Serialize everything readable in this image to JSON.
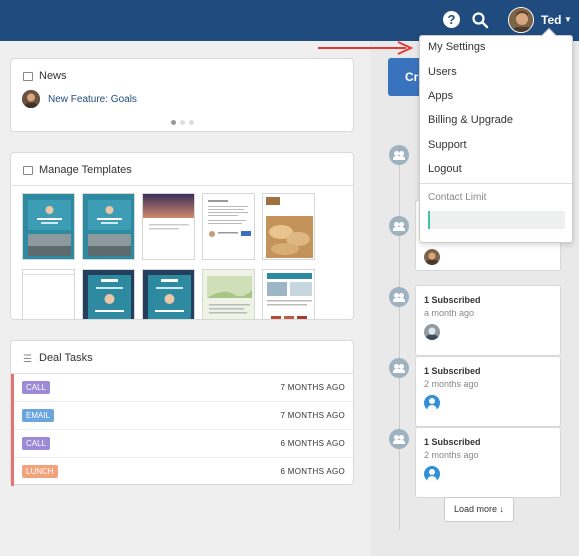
{
  "topbar": {
    "help_icon": "?",
    "username": "Ted",
    "caret": "⌄"
  },
  "user_menu": {
    "items": [
      {
        "label": "My Settings"
      },
      {
        "label": "Users"
      },
      {
        "label": "Apps"
      },
      {
        "label": "Billing & Upgrade"
      },
      {
        "label": "Support"
      },
      {
        "label": "Logout"
      }
    ],
    "contact_limit_label": "Contact Limit",
    "contact_limit_value": 0.01
  },
  "news": {
    "title": "News",
    "item": "New Feature: Goals"
  },
  "templates": {
    "title": "Manage Templates"
  },
  "deal_tasks": {
    "title": "Deal Tasks",
    "rows": [
      {
        "type": "CALL",
        "ago": "7 MONTHS AGO",
        "color": "#9c8ad6"
      },
      {
        "type": "EMAIL",
        "ago": "7 MONTHS AGO",
        "color": "#6aa5e0"
      },
      {
        "type": "CALL",
        "ago": "6 MONTHS AGO",
        "color": "#9c8ad6"
      },
      {
        "type": "LUNCH",
        "ago": "6 MONTHS AGO",
        "color": "#f2a37c"
      }
    ]
  },
  "create_button": {
    "label": "Cre"
  },
  "activity": [
    {
      "title": "1 Subscribed",
      "time": "a month ago",
      "avatar": "photo-gray"
    },
    {
      "title": "1 Subscribed",
      "time": "2 months ago",
      "avatar": "default-blue"
    },
    {
      "title": "1 Subscribed",
      "time": "2 months ago",
      "avatar": "default-blue"
    }
  ],
  "load_more": {
    "label": "Load more ↓"
  },
  "colors": {
    "topbar": "#1f4b7f",
    "primary_button": "#3a73bd",
    "annotation_arrow": "#e53935"
  }
}
